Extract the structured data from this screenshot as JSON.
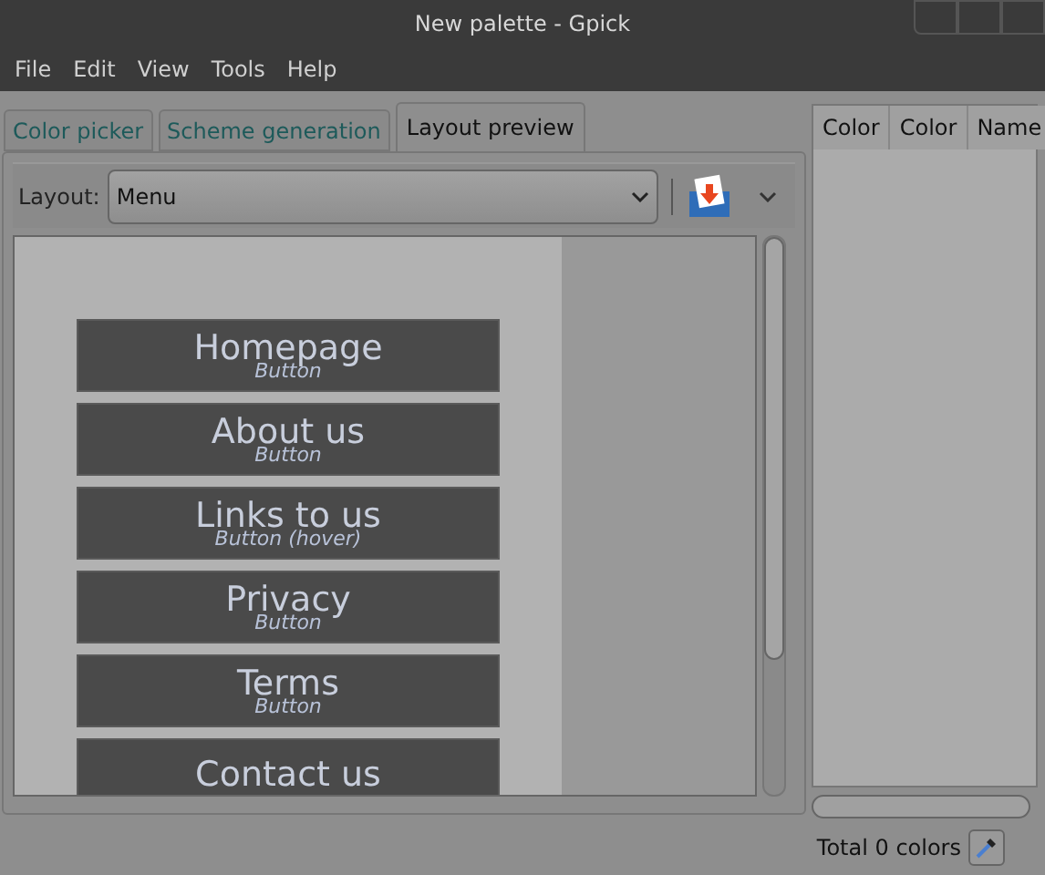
{
  "window": {
    "title": "New palette - Gpick"
  },
  "menu": [
    "File",
    "Edit",
    "View",
    "Tools",
    "Help"
  ],
  "tabs": [
    {
      "label": "Color picker",
      "selected": false
    },
    {
      "label": "Scheme generation",
      "selected": false
    },
    {
      "label": "Layout preview",
      "selected": true
    }
  ],
  "layout_bar": {
    "label": "Layout:",
    "value": "Menu"
  },
  "preview_items": [
    {
      "label": "Homepage",
      "sublabel": "Button"
    },
    {
      "label": "About us",
      "sublabel": "Button"
    },
    {
      "label": "Links to us",
      "sublabel": "Button (hover)"
    },
    {
      "label": "Privacy",
      "sublabel": "Button"
    },
    {
      "label": "Terms",
      "sublabel": "Button"
    },
    {
      "label": "Contact us"
    }
  ],
  "palette_columns": [
    "Color",
    "Color",
    "Name"
  ],
  "status_bar": {
    "text": "Total 0 colors"
  }
}
